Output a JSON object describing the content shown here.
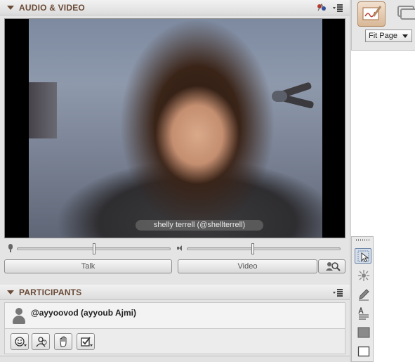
{
  "audio_video": {
    "title": "AUDIO & VIDEO",
    "video_caption": "shelly terrell (@shellterrell)",
    "mic_level": 0.5,
    "speaker_level": 0.43,
    "talk_label": "Talk",
    "video_label": "Video",
    "icons": [
      "mic-icon",
      "speaker-icon",
      "search-person-icon",
      "connection-icon",
      "menu-icon"
    ]
  },
  "participants": {
    "title": "PARTICIPANTS",
    "items": [
      {
        "name": "@ayyoovod (ayyoub Ajmi)"
      }
    ],
    "tools": [
      "emoticon-icon",
      "activity-icon",
      "raise-hand-icon",
      "poll-check-icon"
    ]
  },
  "whiteboard": {
    "zoom_select": "Fit Page",
    "tools": [
      "selection-arrow-icon",
      "pointer-icon",
      "pencil-icon",
      "text-icon",
      "filled-rectangle-icon",
      "rectangle-icon"
    ]
  },
  "colors": {
    "header_text": "#6a4a36",
    "panel_bg": "#e4e4e4",
    "active_tool": "#d4dde8"
  }
}
